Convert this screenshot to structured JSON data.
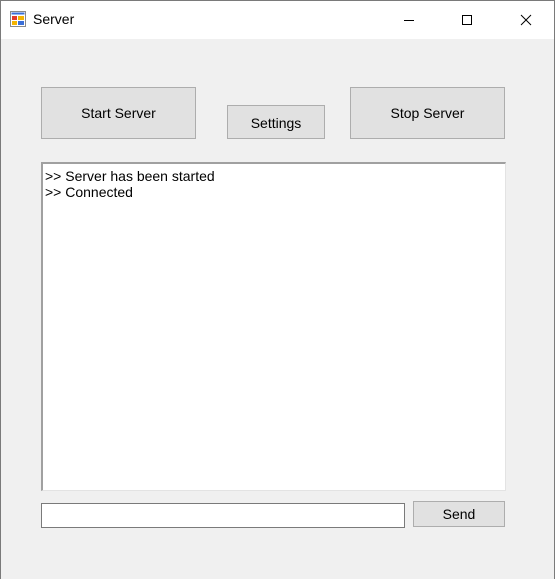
{
  "window": {
    "title": "Server",
    "icon": "windows-form-icon"
  },
  "caption_buttons": {
    "minimize_icon": "minimize-icon",
    "maximize_icon": "maximize-icon",
    "close_icon": "close-icon"
  },
  "toolbar": {
    "start_label": "Start Server",
    "settings_label": "Settings",
    "stop_label": "Stop Server"
  },
  "log": {
    "lines": [
      ">> Server has been started",
      ">> Connected"
    ]
  },
  "message": {
    "value": "",
    "placeholder": ""
  },
  "send": {
    "label": "Send"
  },
  "colors": {
    "window_bg": "#f0f0f0",
    "button_bg": "#e1e1e1",
    "button_border": "#adadad",
    "titlebar_bg": "#ffffff"
  }
}
